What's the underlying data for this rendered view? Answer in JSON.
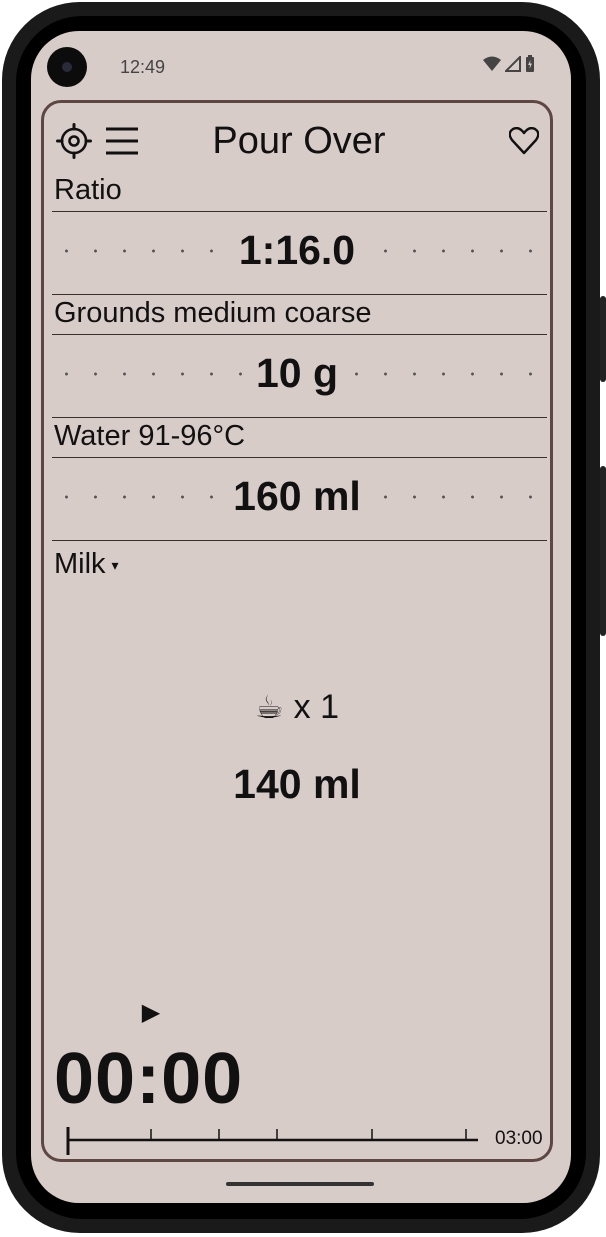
{
  "status_bar": {
    "time": "12:49"
  },
  "header": {
    "title": "Pour Over",
    "settings_icon": "gear-icon",
    "menu_icon": "menu-icon",
    "favorite_icon": "heart-icon"
  },
  "sections": {
    "ratio": {
      "label": "Ratio",
      "value": "1:16.0"
    },
    "grounds": {
      "label": "Grounds medium coarse",
      "value": "10 g"
    },
    "water": {
      "label": "Water 91-96°C",
      "value": "160 ml"
    }
  },
  "milk": {
    "label": "Milk",
    "caret": "▾"
  },
  "cups": {
    "icon": "☕",
    "count_text": "x 1",
    "amount": "140 ml"
  },
  "timer": {
    "play_icon": "▶",
    "elapsed": "00:00",
    "duration": "03:00",
    "progress": 0
  },
  "colors": {
    "background": "#d8ccc9",
    "card_border": "#5e4743",
    "text": "#111111"
  }
}
